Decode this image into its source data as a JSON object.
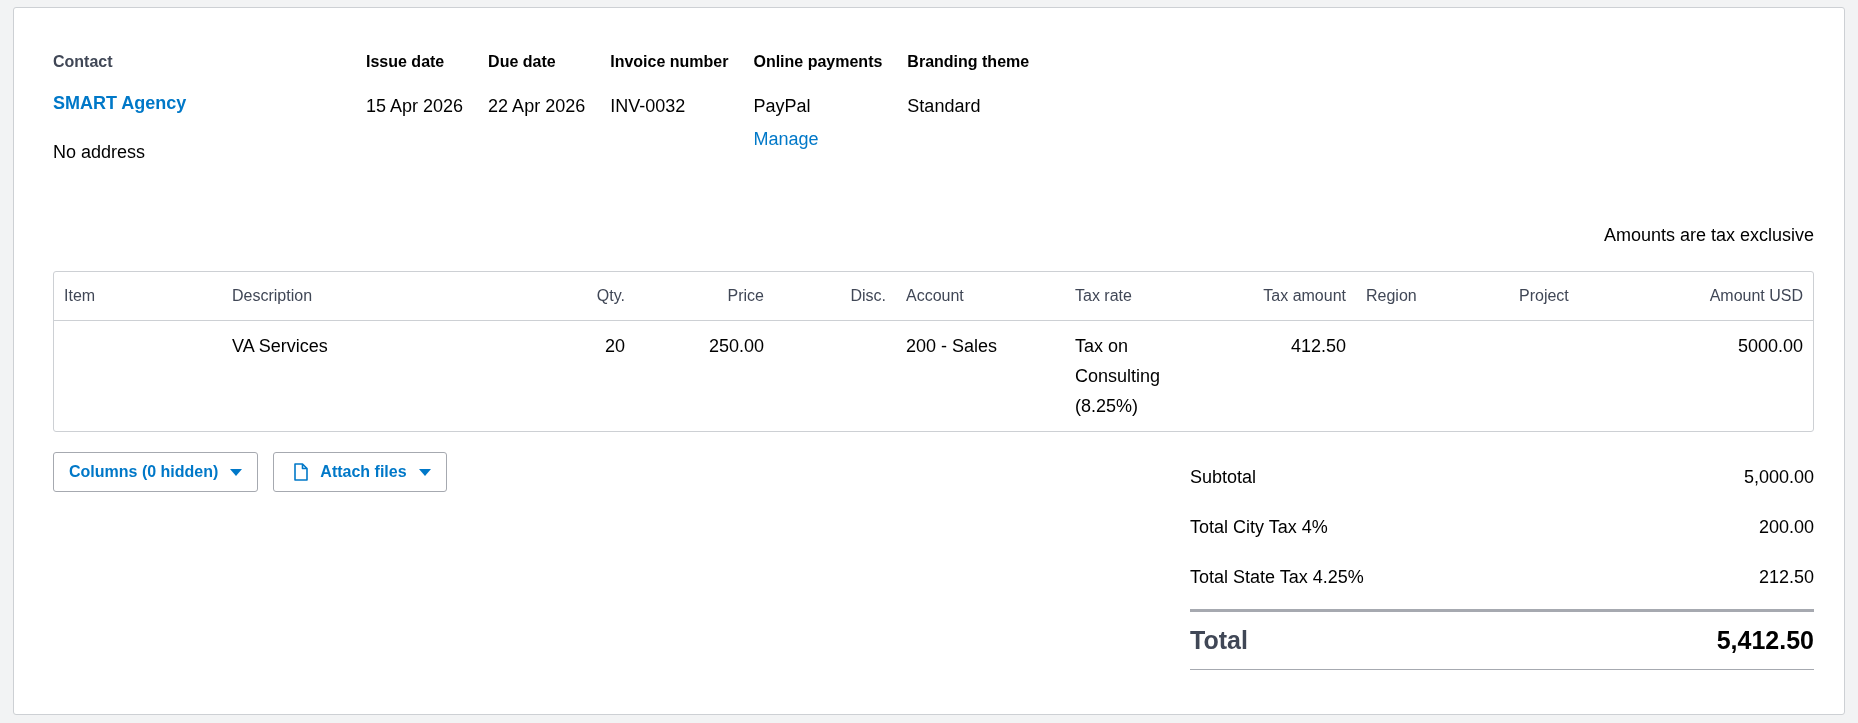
{
  "contact": {
    "label": "Contact",
    "name": "SMART Agency",
    "address": "No address"
  },
  "details": [
    {
      "label": "Issue date",
      "value": "15 Apr 2026"
    },
    {
      "label": "Due date",
      "value": "22 Apr 2026"
    },
    {
      "label": "Invoice number",
      "value": "INV-0032"
    },
    {
      "label": "Online payments",
      "value": "PayPal",
      "link": "Manage"
    },
    {
      "label": "Branding theme",
      "value": "Standard"
    }
  ],
  "tax_note": "Amounts are tax exclusive",
  "table": {
    "columns": [
      "Item",
      "Description",
      "Qty.",
      "Price",
      "Disc.",
      "Account",
      "Tax rate",
      "Tax amount",
      "Region",
      "Project",
      "Amount USD"
    ],
    "rows": [
      {
        "description": "VA Services",
        "qty": "20",
        "price": "250.00",
        "account": "200 - Sales",
        "tax_rate": "Tax on Consulting (8.25%)",
        "tax_amount": "412.50",
        "amount_usd": "5000.00"
      }
    ]
  },
  "buttons": [
    {
      "label": "Columns (0 hidden)",
      "kind": "menu"
    },
    {
      "label": "Attach files",
      "kind": "attach"
    }
  ],
  "totals": [
    {
      "label": "Subtotal",
      "value": "5,000.00"
    },
    {
      "label": "Total City Tax 4%",
      "value": "200.00"
    },
    {
      "label": "Total State Tax 4.25%",
      "value": "212.50"
    }
  ],
  "grand_total": {
    "label": "Total",
    "value": "5,412.50"
  }
}
